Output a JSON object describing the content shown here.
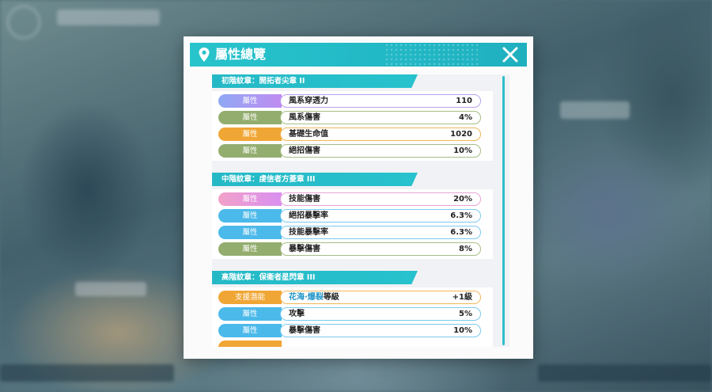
{
  "modal": {
    "title": "屬性總覽"
  },
  "sections": [
    {
      "title": "初階紋章：開拓者尖章 II",
      "rows": [
        {
          "tag": "屬性",
          "name": "風系穿透力",
          "value": "110",
          "color": "purple"
        },
        {
          "tag": "屬性",
          "name": "風系傷害",
          "value": "4%",
          "color": "green"
        },
        {
          "tag": "屬性",
          "name": "基礎生命值",
          "value": "1020",
          "color": "orange"
        },
        {
          "tag": "屬性",
          "name": "絕招傷害",
          "value": "10%",
          "color": "green"
        }
      ]
    },
    {
      "title": "中階紋章：虔信者方菱章 III",
      "rows": [
        {
          "tag": "屬性",
          "name": "技能傷害",
          "value": "20%",
          "color": "pink"
        },
        {
          "tag": "屬性",
          "name": "絕招暴擊率",
          "value": "6.3%",
          "color": "blue"
        },
        {
          "tag": "屬性",
          "name": "技能暴擊率",
          "value": "6.3%",
          "color": "blue"
        },
        {
          "tag": "屬性",
          "name": "暴擊傷害",
          "value": "8%",
          "color": "green"
        }
      ]
    },
    {
      "title": "高階紋章：保衛者星閃章 III",
      "rows": [
        {
          "tag": "支援潛能",
          "name_highlight": "花海·爆裂",
          "name": "等級",
          "value": "+1級",
          "color": "orange"
        },
        {
          "tag": "屬性",
          "name": "攻擊",
          "value": "5%",
          "color": "blue"
        },
        {
          "tag": "屬性",
          "name": "暴擊傷害",
          "value": "10%",
          "color": "blue"
        }
      ]
    }
  ],
  "colors": {
    "header": "#27c4cc",
    "purple": "#b7a2ee",
    "green": "#93ad6e",
    "orange": "#f0a635",
    "pink": "#e6a3d8",
    "blue": "#4bb9ea"
  },
  "icons": {
    "header_left": "location-pin-icon",
    "header_right": "close-icon"
  }
}
